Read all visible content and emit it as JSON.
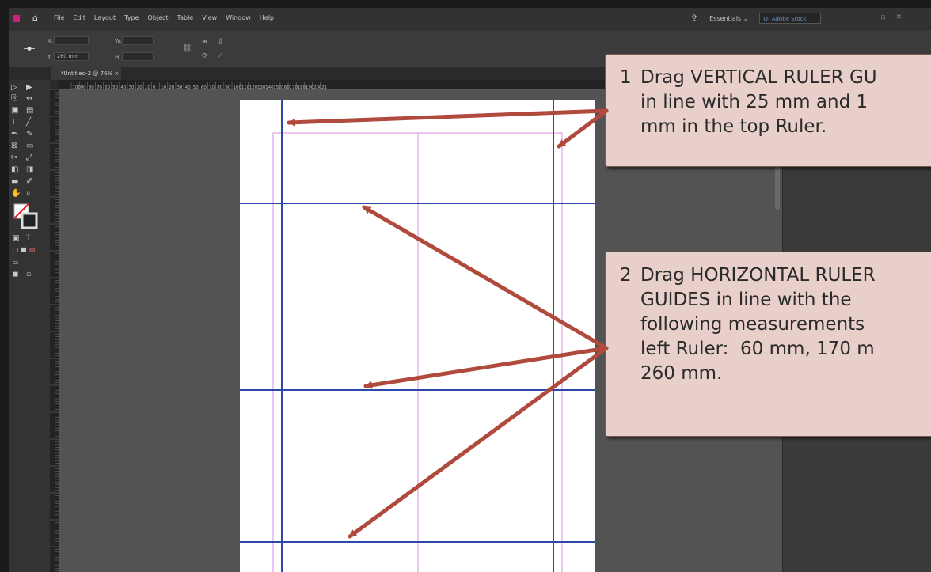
{
  "menubar": {
    "items": [
      "File",
      "Edit",
      "Layout",
      "Type",
      "Object",
      "Table",
      "View",
      "Window",
      "Help"
    ],
    "workspace": "Essentials",
    "stock_placeholder": "Q- Adobe Stock"
  },
  "control": {
    "x_label": "X:",
    "y_label": "Y:",
    "y_value": "260 mm",
    "w_label": "W:",
    "h_label": "H:"
  },
  "document_tab": {
    "title": "*Untitled-2 @ 76%"
  },
  "ruler": {
    "h_labels": [
      "100",
      "90",
      "80",
      "70",
      "60",
      "50",
      "40",
      "30",
      "20",
      "10",
      "0",
      "10",
      "20",
      "30",
      "40",
      "50",
      "60",
      "70",
      "80",
      "90",
      "100",
      "110",
      "120",
      "130",
      "140",
      "150",
      "160",
      "170",
      "180",
      "190",
      "200",
      "21"
    ]
  },
  "callouts": {
    "step1": {
      "number": "1",
      "lines": [
        "Drag VERTICAL RULER GU",
        "in line with 25 mm and 1",
        "mm in the top Ruler."
      ]
    },
    "step2": {
      "number": "2",
      "lines": [
        "Drag HORIZONTAL RULER",
        "GUIDES in line with the",
        "following measurements",
        "left Ruler:  60 mm, 170 m",
        "260 mm."
      ]
    }
  },
  "colors": {
    "guide": "#2e4aa8",
    "arrow": "#b04a3c",
    "callout_fill": "#e8cfc9",
    "margin_guide": "#d48fd8"
  }
}
